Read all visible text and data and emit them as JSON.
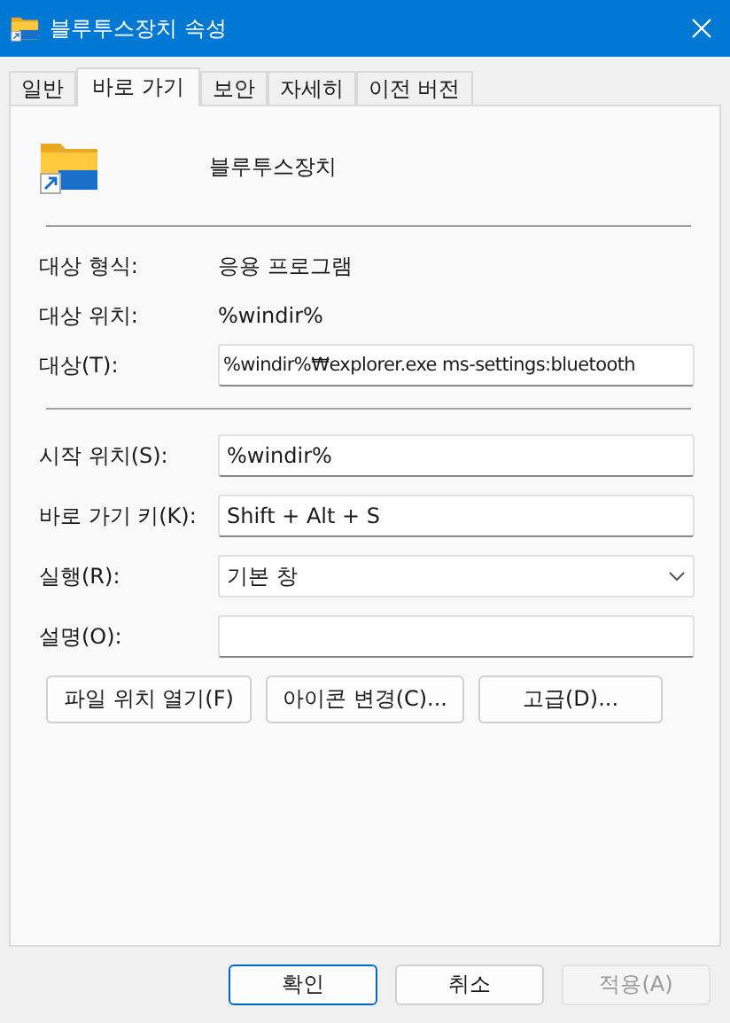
{
  "window": {
    "title": "블루투스장치 속성"
  },
  "tabs": [
    {
      "label": "일반",
      "selected": false
    },
    {
      "label": "바로 가기",
      "selected": true
    },
    {
      "label": "보안",
      "selected": false
    },
    {
      "label": "자세히",
      "selected": false
    },
    {
      "label": "이전 버전",
      "selected": false
    }
  ],
  "shortcut_name": "블루투스장치",
  "info_rows": [
    {
      "label": "대상 형식:",
      "value": "응용 프로그램"
    },
    {
      "label": "대상 위치:",
      "value": "%windir%"
    }
  ],
  "target": {
    "label": "대상(T):",
    "value": "%windir%₩explorer.exe ms-settings:bluetooth"
  },
  "fields": [
    {
      "kind": "input",
      "label": "시작 위치(S):",
      "value": "%windir%"
    },
    {
      "kind": "input",
      "label": "바로 가기 키(K):",
      "value": "Shift + Alt + S"
    },
    {
      "kind": "select",
      "label": "실행(R):",
      "value": "기본 창"
    },
    {
      "kind": "input",
      "label": "설명(O):"
    }
  ],
  "action_buttons": [
    "파일 위치 열기(F)",
    "아이콘 변경(C)...",
    "고급(D)..."
  ],
  "dialog_buttons": [
    {
      "label": "확인",
      "default": true,
      "disabled": false
    },
    {
      "label": "취소",
      "default": false,
      "disabled": false
    },
    {
      "label": "적용(A)",
      "default": false,
      "disabled": true
    }
  ]
}
